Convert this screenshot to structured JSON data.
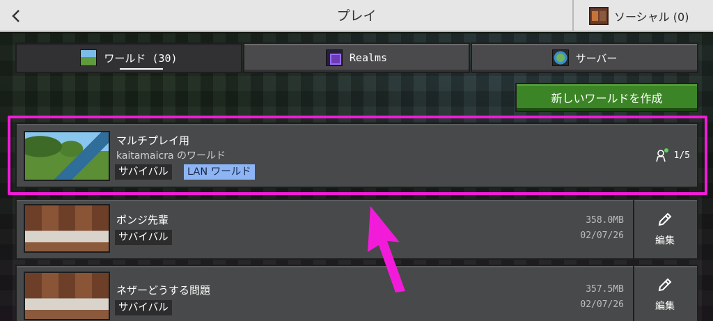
{
  "header": {
    "title": "プレイ",
    "back_icon": "chevron-left-icon",
    "social_label": "ソーシャル (0)",
    "social_icon": "friends-avatar-icon"
  },
  "tabs": [
    {
      "label": "ワールド (30)",
      "icon": "grass-block-icon",
      "active": true
    },
    {
      "label": "Realms",
      "icon": "realms-portal-icon",
      "active": false
    },
    {
      "label": "サーバー",
      "icon": "globe-icon",
      "active": false
    }
  ],
  "create_world_label": "新しいワールドを作成",
  "worlds": [
    {
      "name": "マルチプレイ用",
      "subtitle": "kaitamaicra のワールド",
      "mode": "サバイバル",
      "lan_badge": "LAN ワールド",
      "players": "1/5"
    },
    {
      "name": "ポンジ先輩",
      "mode": "サバイバル",
      "size": "358.0MB",
      "date": "02/07/26",
      "edit_label": "編集"
    },
    {
      "name": "ネザーどうする問題",
      "mode": "サバイバル",
      "size": "357.5MB",
      "date": "02/07/26",
      "edit_label": "編集"
    }
  ],
  "colors": {
    "header_bg": "#e6e6e6",
    "create_button": "#3c8527",
    "highlight": "#f21bd9",
    "lan_badge_bg": "#8db5f5"
  }
}
